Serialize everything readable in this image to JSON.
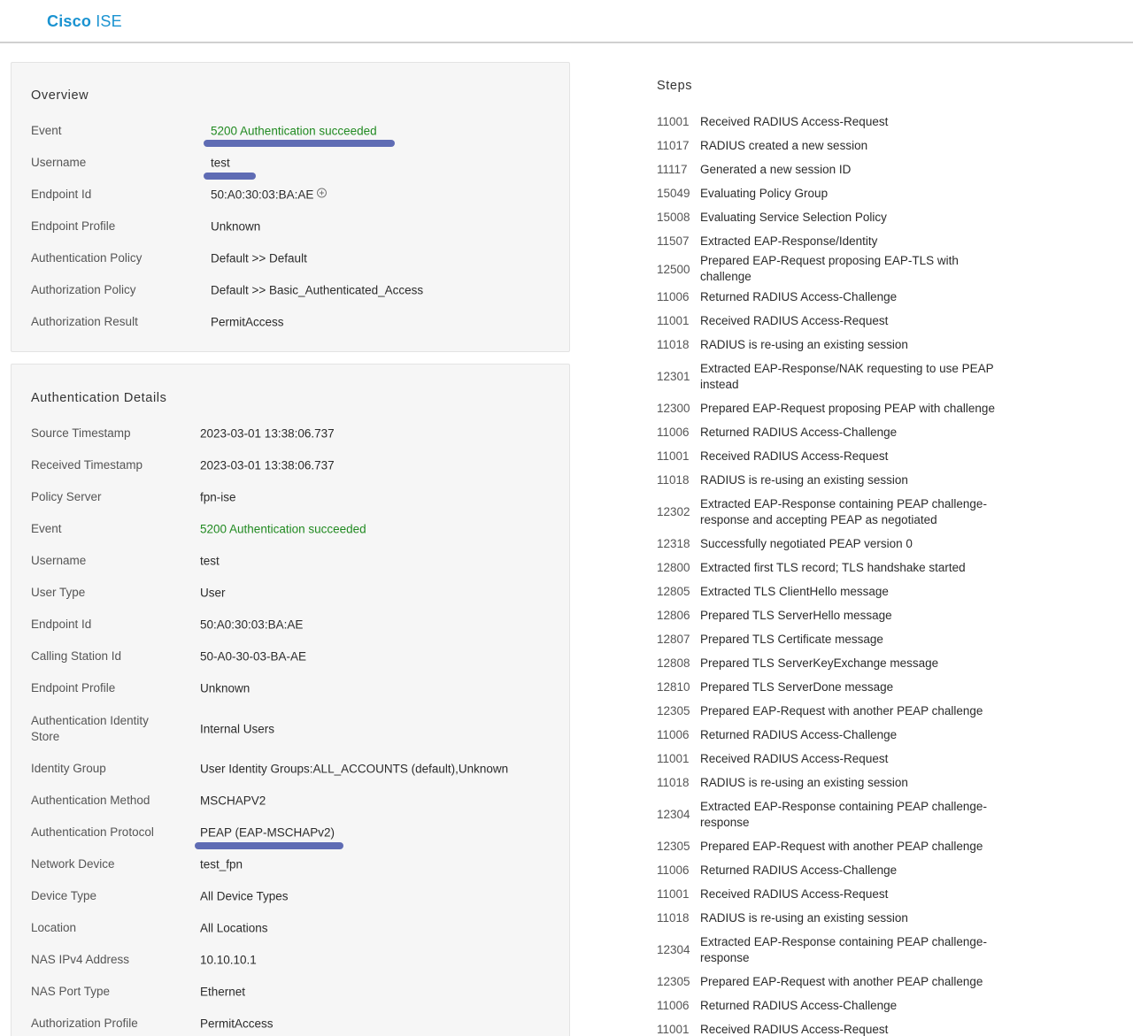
{
  "app": {
    "brand": "Cisco",
    "product": "ISE"
  },
  "overview": {
    "title": "Overview",
    "rows": [
      {
        "label": "Event",
        "value": "5200 Authentication succeeded"
      },
      {
        "label": "Username",
        "value": "test"
      },
      {
        "label": "Endpoint Id",
        "value": "50:A0:30:03:BA:AE"
      },
      {
        "label": "Endpoint Profile",
        "value": "Unknown"
      },
      {
        "label": "Authentication Policy",
        "value": "Default >> Default"
      },
      {
        "label": "Authorization Policy",
        "value": "Default >> Basic_Authenticated_Access"
      },
      {
        "label": "Authorization Result",
        "value": "PermitAccess"
      }
    ]
  },
  "auth_details": {
    "title": "Authentication Details",
    "rows": [
      {
        "label": "Source Timestamp",
        "value": "2023-03-01 13:38:06.737"
      },
      {
        "label": "Received Timestamp",
        "value": "2023-03-01 13:38:06.737"
      },
      {
        "label": "Policy Server",
        "value": "fpn-ise"
      },
      {
        "label": "Event",
        "value": "5200 Authentication succeeded"
      },
      {
        "label": "Username",
        "value": "test"
      },
      {
        "label": "User Type",
        "value": "User"
      },
      {
        "label": "Endpoint Id",
        "value": "50:A0:30:03:BA:AE"
      },
      {
        "label": "Calling Station Id",
        "value": "50-A0-30-03-BA-AE"
      },
      {
        "label": "Endpoint Profile",
        "value": "Unknown"
      },
      {
        "label": "Authentication Identity Store",
        "value": "Internal Users"
      },
      {
        "label": "Identity Group",
        "value": "User Identity Groups:ALL_ACCOUNTS (default),Unknown"
      },
      {
        "label": "Authentication Method",
        "value": "MSCHAPV2"
      },
      {
        "label": "Authentication Protocol",
        "value": "PEAP (EAP-MSCHAPv2)"
      },
      {
        "label": "Network Device",
        "value": "test_fpn"
      },
      {
        "label": "Device Type",
        "value": "All Device Types"
      },
      {
        "label": "Location",
        "value": "All Locations"
      },
      {
        "label": "NAS IPv4 Address",
        "value": "10.10.10.1"
      },
      {
        "label": "NAS Port Type",
        "value": "Ethernet"
      },
      {
        "label": "Authorization Profile",
        "value": "PermitAccess"
      }
    ]
  },
  "steps": {
    "title": "Steps",
    "items": [
      {
        "code": "11001",
        "text": "Received RADIUS Access-Request"
      },
      {
        "code": "11017",
        "text": "RADIUS created a new session"
      },
      {
        "code": "11117",
        "text": "Generated a new session ID"
      },
      {
        "code": "15049",
        "text": "Evaluating Policy Group"
      },
      {
        "code": "15008",
        "text": "Evaluating Service Selection Policy"
      },
      {
        "code": "11507",
        "text": "Extracted EAP-Response/Identity"
      },
      {
        "code": "12500",
        "text": "Prepared EAP-Request proposing EAP-TLS with challenge"
      },
      {
        "code": "11006",
        "text": "Returned RADIUS Access-Challenge"
      },
      {
        "code": "11001",
        "text": "Received RADIUS Access-Request"
      },
      {
        "code": "11018",
        "text": "RADIUS is re-using an existing session"
      },
      {
        "code": "12301",
        "text": "Extracted EAP-Response/NAK requesting to use PEAP instead"
      },
      {
        "code": "12300",
        "text": "Prepared EAP-Request proposing PEAP with challenge"
      },
      {
        "code": "11006",
        "text": "Returned RADIUS Access-Challenge"
      },
      {
        "code": "11001",
        "text": "Received RADIUS Access-Request"
      },
      {
        "code": "11018",
        "text": "RADIUS is re-using an existing session"
      },
      {
        "code": "12302",
        "text": "Extracted EAP-Response containing PEAP challenge-response and accepting PEAP as negotiated"
      },
      {
        "code": "12318",
        "text": "Successfully negotiated PEAP version 0"
      },
      {
        "code": "12800",
        "text": "Extracted first TLS record; TLS handshake started"
      },
      {
        "code": "12805",
        "text": "Extracted TLS ClientHello message"
      },
      {
        "code": "12806",
        "text": "Prepared TLS ServerHello message"
      },
      {
        "code": "12807",
        "text": "Prepared TLS Certificate message"
      },
      {
        "code": "12808",
        "text": "Prepared TLS ServerKeyExchange message"
      },
      {
        "code": "12810",
        "text": "Prepared TLS ServerDone message"
      },
      {
        "code": "12305",
        "text": "Prepared EAP-Request with another PEAP challenge"
      },
      {
        "code": "11006",
        "text": "Returned RADIUS Access-Challenge"
      },
      {
        "code": "11001",
        "text": "Received RADIUS Access-Request"
      },
      {
        "code": "11018",
        "text": "RADIUS is re-using an existing session"
      },
      {
        "code": "12304",
        "text": "Extracted EAP-Response containing PEAP challenge-response"
      },
      {
        "code": "12305",
        "text": "Prepared EAP-Request with another PEAP challenge"
      },
      {
        "code": "11006",
        "text": "Returned RADIUS Access-Challenge"
      },
      {
        "code": "11001",
        "text": "Received RADIUS Access-Request"
      },
      {
        "code": "11018",
        "text": "RADIUS is re-using an existing session"
      },
      {
        "code": "12304",
        "text": "Extracted EAP-Response containing PEAP challenge-response"
      },
      {
        "code": "12305",
        "text": "Prepared EAP-Request with another PEAP challenge"
      },
      {
        "code": "11006",
        "text": "Returned RADIUS Access-Challenge"
      },
      {
        "code": "11001",
        "text": "Received RADIUS Access-Request"
      }
    ]
  }
}
